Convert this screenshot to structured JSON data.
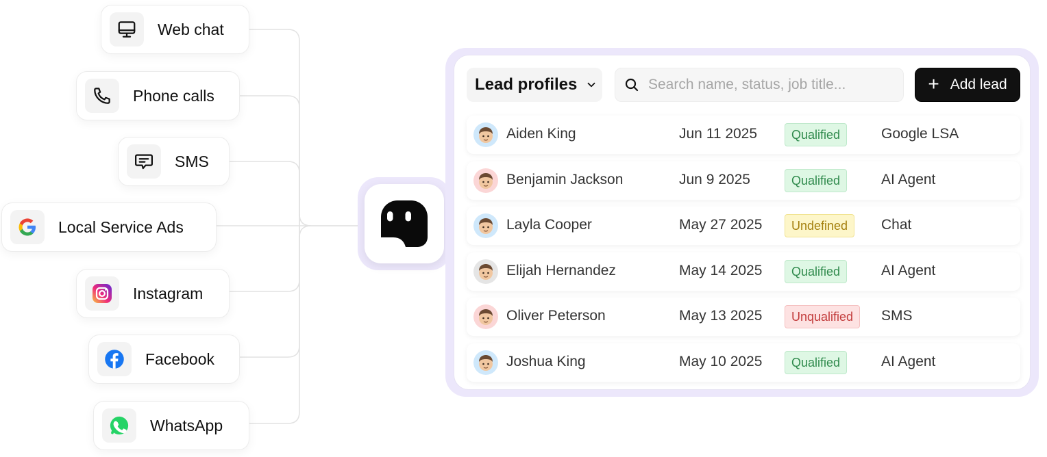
{
  "channels": [
    {
      "label": "Web chat",
      "icon": "monitor-icon"
    },
    {
      "label": "Phone calls",
      "icon": "phone-icon"
    },
    {
      "label": "SMS",
      "icon": "message-icon"
    },
    {
      "label": "Local Service Ads",
      "icon": "google-icon"
    },
    {
      "label": "Instagram",
      "icon": "instagram-icon"
    },
    {
      "label": "Facebook",
      "icon": "facebook-icon"
    },
    {
      "label": "WhatsApp",
      "icon": "whatsapp-icon"
    }
  ],
  "hub": {
    "icon": "app-logo-icon"
  },
  "panel": {
    "dropdown_label": "Lead profiles",
    "search_placeholder": "Search name, status, job title...",
    "add_button_label": "Add lead",
    "status_colors": {
      "Qualified": {
        "bg": "#def7e4",
        "border": "#bfe9cb",
        "text": "#2f8a4c"
      },
      "Undefined": {
        "bg": "#fdf6c9",
        "border": "#f1e391",
        "text": "#a47f0d"
      },
      "Unqualified": {
        "bg": "#fde2e2",
        "border": "#f5c0c0",
        "text": "#c23b3b"
      }
    },
    "rows": [
      {
        "name": "Aiden King",
        "date": "Jun 11 2025",
        "status": "Qualified",
        "source": "Google LSA",
        "avatar_color": "#cfe8fb"
      },
      {
        "name": "Benjamin Jackson",
        "date": "Jun 9 2025",
        "status": "Qualified",
        "source": "AI Agent",
        "avatar_color": "#fbd6d6"
      },
      {
        "name": "Layla Cooper",
        "date": "May 27 2025",
        "status": "Undefined",
        "source": "Chat",
        "avatar_color": "#cfe8fb"
      },
      {
        "name": "Elijah Hernandez",
        "date": "May 14 2025",
        "status": "Qualified",
        "source": "AI Agent",
        "avatar_color": "#e5e5e5"
      },
      {
        "name": "Oliver Peterson",
        "date": "May 13 2025",
        "status": "Unqualified",
        "source": "SMS",
        "avatar_color": "#fbd6d6"
      },
      {
        "name": "Joshua King",
        "date": "May 10 2025",
        "status": "Qualified",
        "source": "AI Agent",
        "avatar_color": "#cfe8fb"
      }
    ]
  }
}
